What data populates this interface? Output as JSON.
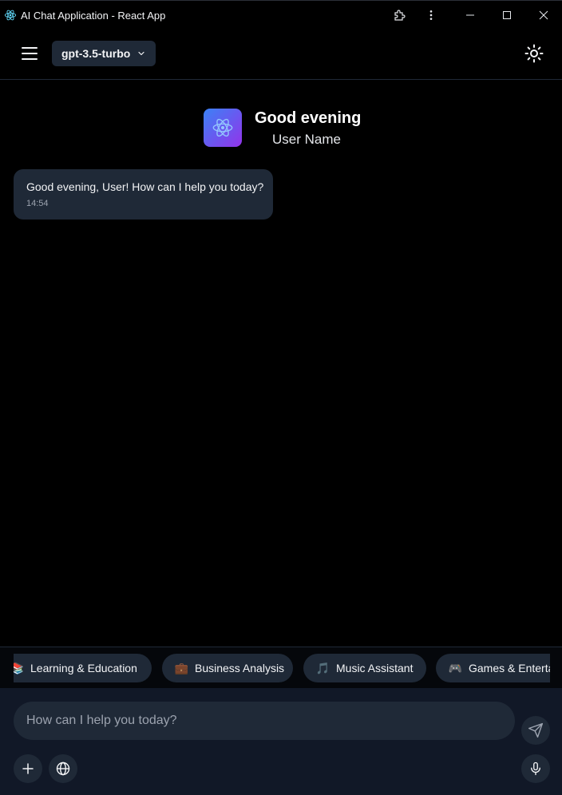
{
  "window": {
    "title": "AI Chat Application - React App"
  },
  "header": {
    "model": "gpt-3.5-turbo"
  },
  "greeting": {
    "title": "Good evening",
    "subtitle": "User Name"
  },
  "messages": [
    {
      "text": "Good evening, User! How can I help you today?",
      "time": "14:54"
    }
  ],
  "suggestions": [
    {
      "icon": "books-icon",
      "emoji": "📚",
      "label": "Learning & Education"
    },
    {
      "icon": "briefcase-icon",
      "emoji": "💼",
      "label": "Business Analysis"
    },
    {
      "icon": "music-note-icon",
      "emoji": "🎵",
      "label": "Music Assistant"
    },
    {
      "icon": "game-controller-icon",
      "emoji": "🎮",
      "label": "Games & Entertainment"
    }
  ],
  "composer": {
    "placeholder": "How can I help you today?"
  },
  "colors": {
    "background": "#000000",
    "surface": "#1f2937",
    "composer_bg": "#111827",
    "accent_gradient_start": "#3b82f6",
    "accent_gradient_end": "#9333ea"
  }
}
